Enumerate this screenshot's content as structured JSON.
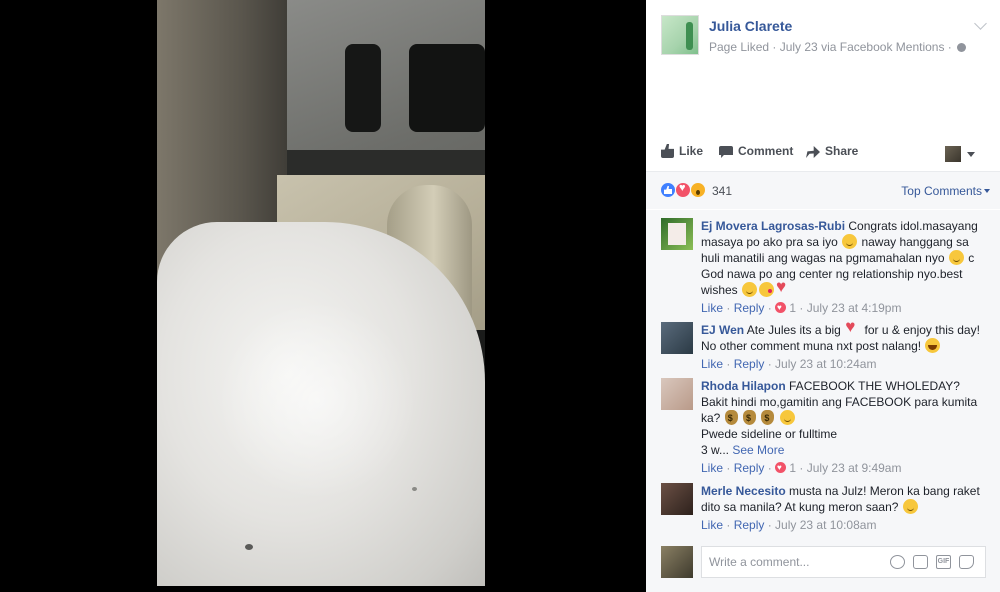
{
  "post": {
    "page_name": "Julia Clarete",
    "meta": "Page Liked · July 23 via Facebook Mentions ·",
    "actions": {
      "like": "Like",
      "comment": "Comment",
      "share": "Share"
    }
  },
  "reactions": {
    "count": "341",
    "sort_label": "Top Comments"
  },
  "comments": [
    {
      "name": "Ej Movera Lagrosas-Rubi",
      "text_1": "Congrats idol.masayang masaya po ako pra sa iyo",
      "text_2": "naway hanggang sa huli manatili ang wagas na pgmamahalan nyo",
      "text_3": "c God nawa po ang center ng relationship nyo.best wishes",
      "like": "Like",
      "reply": "Reply",
      "reaction_count": "1",
      "time": "July 23 at 4:19pm"
    },
    {
      "name": "EJ Wen",
      "text_1": "Ate Jules its a big",
      "text_2": "for u & enjoy this day! No other comment muna nxt post nalang!",
      "like": "Like",
      "reply": "Reply",
      "time": "July 23 at 10:24am"
    },
    {
      "name": "Rhoda Hilapon",
      "text_1": "FACEBOOK THE WHOLEDAY? Bakit hindi mo,gamitin ang FACEBOOK para kumita ka?",
      "text_2": "Pwede sideline or fulltime",
      "text_3": "3 w...",
      "see_more": "See More",
      "like": "Like",
      "reply": "Reply",
      "reaction_count": "1",
      "time": "July 23 at 9:49am"
    },
    {
      "name": "Merle Necesito",
      "text_1": "musta na Julz! Meron ka bang raket dito sa manila? At kung meron saan?",
      "like": "Like",
      "reply": "Reply",
      "time": "July 23 at 10:08am"
    }
  ],
  "composer": {
    "placeholder": "Write a comment..."
  },
  "colors": {
    "link": "#365899",
    "muted": "#90949c",
    "panel_bg": "#f6f7f9",
    "love": "#f25268",
    "like_blue": "#4080ff"
  },
  "icons": [
    "globe-icon",
    "chevron-down-icon",
    "like-icon",
    "comment-icon",
    "share-icon",
    "emoji-icon",
    "camera-icon",
    "gif-icon",
    "sticker-icon"
  ]
}
